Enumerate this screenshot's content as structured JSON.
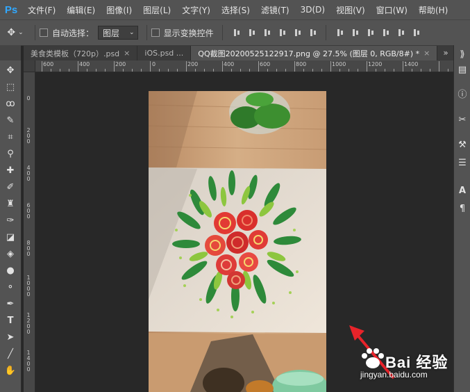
{
  "app": {
    "logo": "Ps"
  },
  "menu": [
    "文件(F)",
    "编辑(E)",
    "图像(I)",
    "图层(L)",
    "文字(Y)",
    "选择(S)",
    "滤镜(T)",
    "3D(D)",
    "视图(V)",
    "窗口(W)",
    "帮助(H)"
  ],
  "options": {
    "auto_select_label": "自动选择：",
    "auto_select_value": "图层",
    "show_transform_label": "显示变换控件"
  },
  "tabs": [
    {
      "label": "美食类模板（720p）.psd",
      "close": "×",
      "active": false
    },
    {
      "label": "iOS.psd ...",
      "close": "",
      "active": false
    },
    {
      "label": "QQ截图20200525122917.png @ 27.5% (图层 0, RGB/8#) *",
      "close": "×",
      "active": true
    }
  ],
  "tabs_more": "»",
  "ruler_top": [
    "600",
    "400",
    "200",
    "0",
    "200",
    "400",
    "600",
    "800",
    "1000",
    "1200",
    "1400"
  ],
  "ruler_left": [
    "0",
    "2 0 0",
    "4 0 0",
    "6 0 0",
    "8 0 0",
    "1 0 0 0",
    "1 2 0 0",
    "1 4 0 0"
  ],
  "watermark": {
    "brand": "Bai 经验",
    "url": "jingyan.baidu.com"
  },
  "colors": {
    "accent": "#31a8ff",
    "arrow": "#e8232a",
    "chrome": "#535353",
    "canvas": "#282828"
  }
}
